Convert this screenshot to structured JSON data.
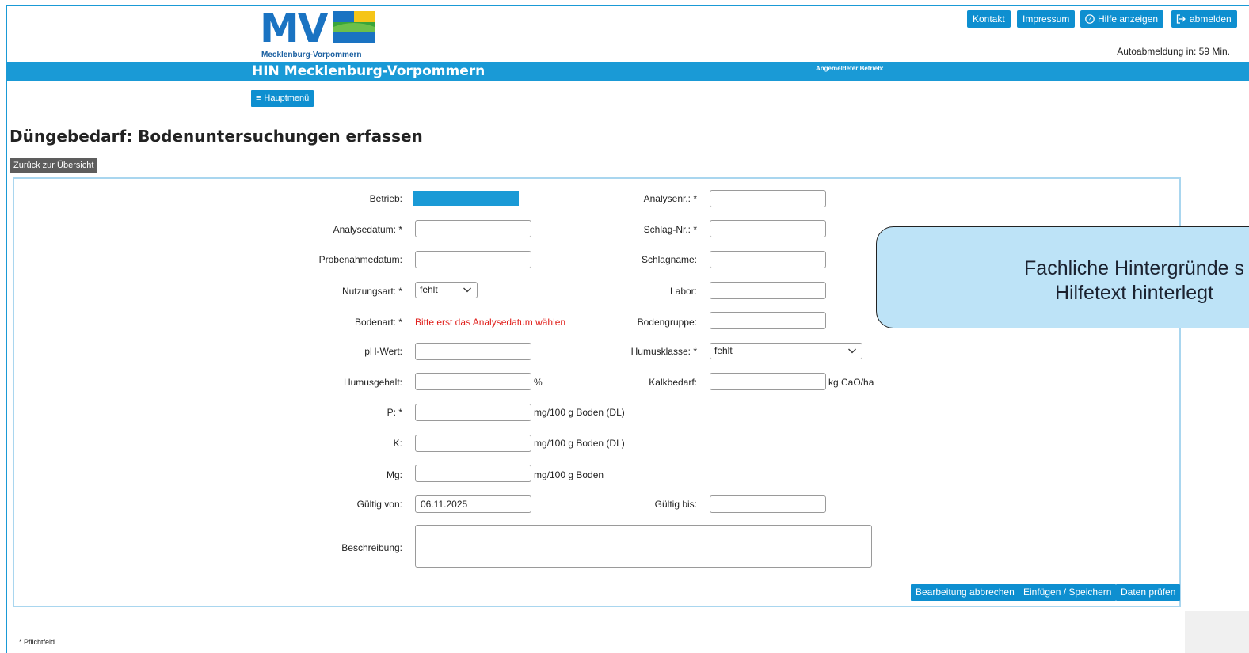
{
  "header": {
    "logo_text": "MV",
    "logo_subtitle": "Mecklenburg-Vorpommern",
    "buttons": {
      "kontakt": "Kontakt",
      "impressum": "Impressum",
      "hilfe": "Hilfe anzeigen",
      "abmelden": "abmelden"
    },
    "autologout": "Autoabmeldung in:  59 Min.",
    "app_title": "HIN Mecklenburg-Vorpommern",
    "logged_in_label": "Angemeldeter Betrieb:",
    "menu_button": "Hauptmenü"
  },
  "page": {
    "title": "Düngebedarf: Bodenuntersuchungen erfassen",
    "back_button": "Zurück zur Übersicht"
  },
  "form": {
    "betrieb_label": "Betrieb:",
    "analysedatum_label": "Analysedatum: *",
    "probenahmedatum_label": "Probenahmedatum:",
    "nutzungsart_label": "Nutzungsart: *",
    "nutzungsart_value": "fehlt",
    "bodenart_label": "Bodenart: *",
    "bodenart_error": "Bitte erst das Analysedatum wählen",
    "ph_label": "pH-Wert:",
    "humusgehalt_label": "Humusgehalt:",
    "humusgehalt_unit": "%",
    "p_label": "P: *",
    "p_unit": "mg/100 g Boden (DL)",
    "k_label": "K:",
    "k_unit": "mg/100 g Boden (DL)",
    "mg_label": "Mg:",
    "mg_unit": "mg/100 g Boden",
    "gueltig_von_label": "Gültig von:",
    "gueltig_von_value": "06.11.2025",
    "beschreibung_label": "Beschreibung:",
    "analysenr_label": "Analysenr.: *",
    "schlagnr_label": "Schlag-Nr.: *",
    "schlagname_label": "Schlagname:",
    "labor_label": "Labor:",
    "bodengruppe_label": "Bodengruppe:",
    "humusklasse_label": "Humusklasse: *",
    "humusklasse_value": "fehlt",
    "kalkbedarf_label": "Kalkbedarf:",
    "kalkbedarf_unit": "kg CaO/ha",
    "gueltig_bis_label": "Gültig bis:"
  },
  "actions": {
    "cancel": "Bearbeitung abbrechen",
    "save": "Einfügen / Speichern",
    "check": "Daten prüfen"
  },
  "footer": {
    "required_note": "* Pflichtfeld"
  },
  "callout": {
    "line1": "Fachliche Hintergründe s",
    "line2": "Hilfetext hinterlegt"
  },
  "colors": {
    "primary": "#1a9ad6",
    "button": "#0e8fd0",
    "error": "#e0201c",
    "callout_bg": "#bde3f7"
  }
}
